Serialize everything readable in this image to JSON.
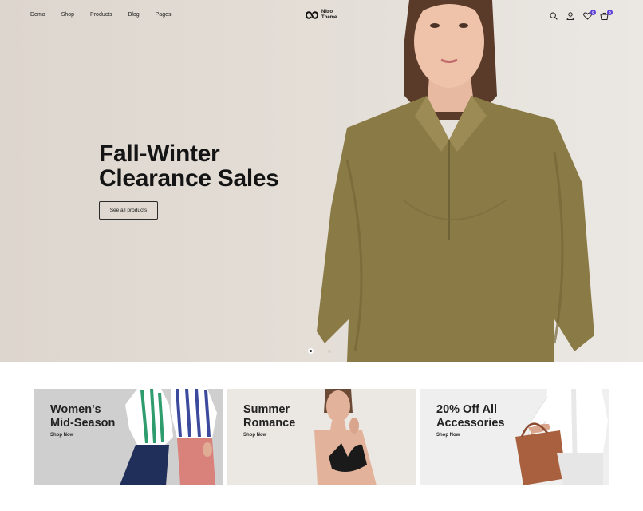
{
  "nav": {
    "links": [
      "Demo",
      "Shop",
      "Products",
      "Blog",
      "Pages"
    ],
    "logo_line1": "Nitro",
    "logo_line2": "Theme",
    "icons": [
      "search-icon",
      "user-icon",
      "heart-icon",
      "cart-icon"
    ],
    "wishlist_count": "0",
    "cart_count": "0"
  },
  "hero": {
    "title_line1": "Fall-Winter",
    "title_line2": "Clearance Sales",
    "button_label": "See all products",
    "slides": 2,
    "active_slide": 1
  },
  "promos": [
    {
      "title_line1": "Women's",
      "title_line2": "Mid-Season",
      "link": "Shop Now"
    },
    {
      "title_line1": "Summer",
      "title_line2": "Romance",
      "link": "Shop Now"
    },
    {
      "title_line1": "20% Off All",
      "title_line2": "Accessories",
      "link": "Shop Now"
    }
  ],
  "colors": {
    "badge": "#5b3fd6",
    "blouse": "#8a7a45",
    "hero_bg": "#e3ddd6",
    "promo1_bg": "#cfcfcf",
    "promo2_bg": "#ebe7e2",
    "promo3_bg": "#efefef"
  }
}
